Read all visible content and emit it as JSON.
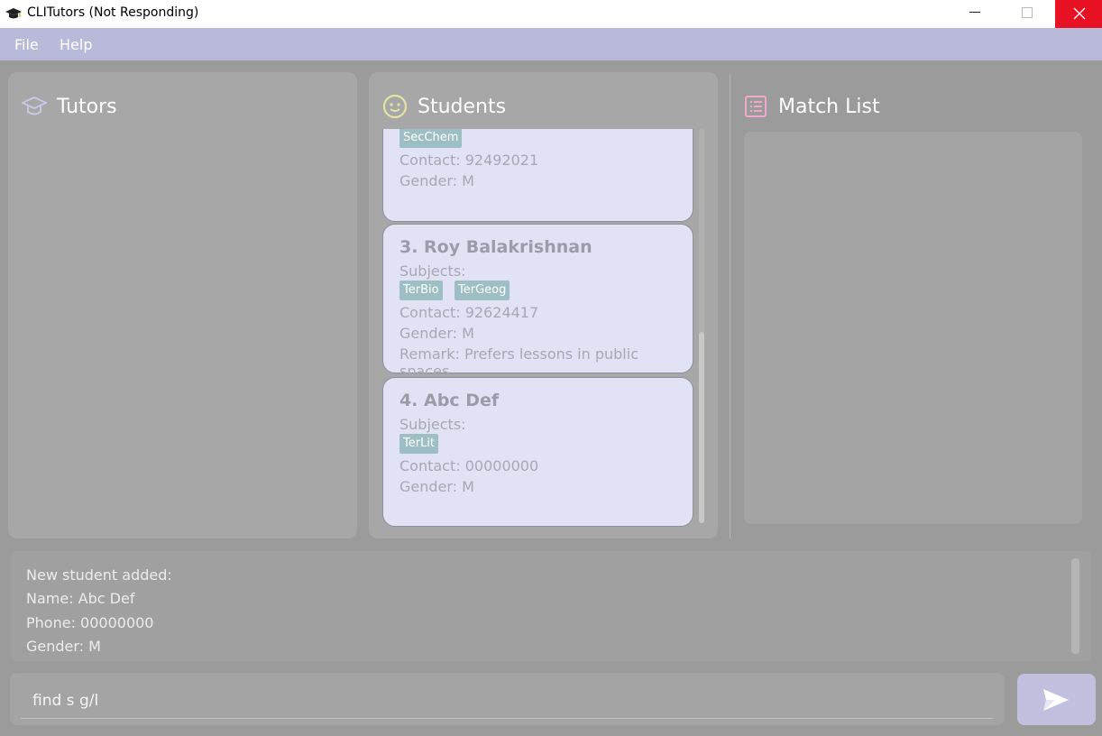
{
  "window": {
    "title": "CLITutors (Not Responding)"
  },
  "menu": {
    "file": "File",
    "help": "Help"
  },
  "panels": {
    "tutors_title": "Tutors",
    "students_title": "Students",
    "match_title": "Match List"
  },
  "students": {
    "card2": {
      "tag": "SecChem",
      "contact": "Contact: 92492021",
      "gender": "Gender: M"
    },
    "card3": {
      "name": "3.  Roy Balakrishnan",
      "subjects_label": "Subjects:",
      "tags": [
        "TerBio",
        "TerGeog"
      ],
      "contact": "Contact: 92624417",
      "gender": "Gender: M",
      "remark": "Remark: Prefers lessons in public spaces"
    },
    "card4": {
      "name": "4.  Abc Def",
      "subjects_label": "Subjects:",
      "tags": [
        "TerLit"
      ],
      "contact": "Contact: 00000000",
      "gender": "Gender: M"
    }
  },
  "result": {
    "lines": [
      "New student added:",
      "Name: Abc Def",
      "Phone: 00000000",
      "Gender: M"
    ]
  },
  "command": {
    "value": "find s g/l"
  },
  "colors": {
    "accent": "#b9b9d9",
    "card_bg": "#e1e3f5",
    "tag_bg": "#9dbfc4",
    "close_red": "#e81123"
  }
}
